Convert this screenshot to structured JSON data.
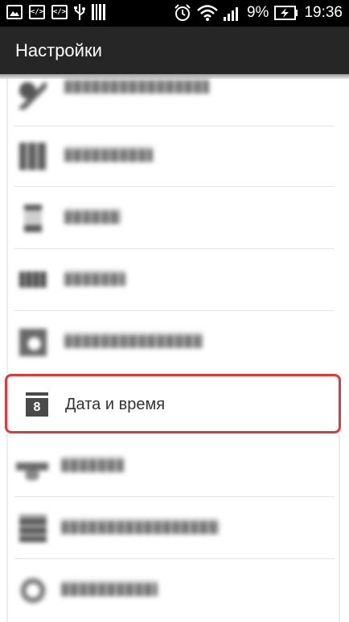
{
  "status_bar": {
    "left_icons": [
      "image-icon",
      "code-icon",
      "code-icon",
      "usb-icon",
      "barcode-icon"
    ],
    "code_glyph": "</>",
    "battery_percent": "9%",
    "time": "19:36"
  },
  "app_bar": {
    "title": "Настройки"
  },
  "settings_list": {
    "selected_item": {
      "label": "Дата и время",
      "icon_number": "8",
      "icon": "calendar-icon"
    }
  },
  "colors": {
    "highlight_border": "#e0393b",
    "app_bar_bg": "#262626",
    "status_bar_bg": "#000000"
  }
}
